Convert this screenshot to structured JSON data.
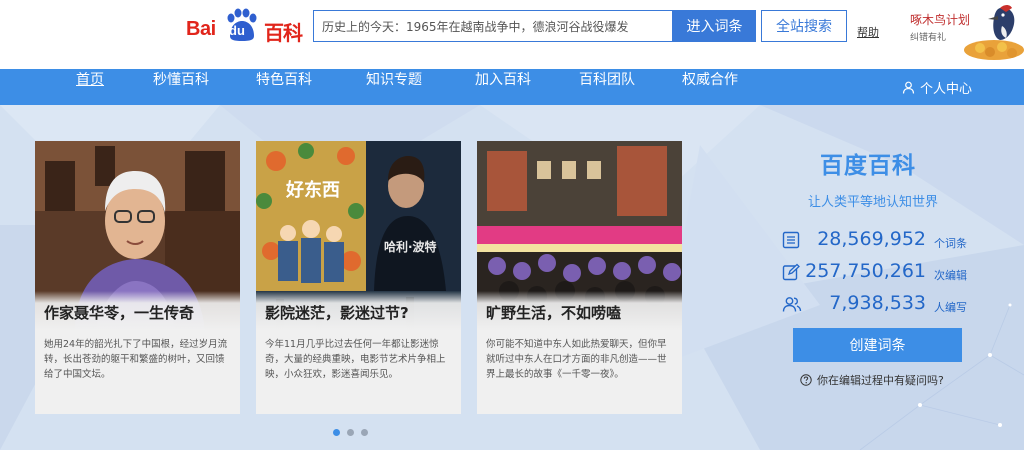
{
  "logo": {
    "part1": "Bai",
    "part2": "du",
    "part3": "百科"
  },
  "search": {
    "value": "历史上的今天：1965年在越南战争中，德浪河谷战役爆发"
  },
  "buttons": {
    "enter": "进入词条",
    "site_search": "全站搜索",
    "help": "帮助"
  },
  "promo": {
    "title": "啄木鸟计划",
    "subtitle": "纠错有礼"
  },
  "nav": {
    "items": [
      "首页",
      "秒懂百科",
      "特色百科",
      "知识专题",
      "加入百科",
      "百科团队",
      "权威合作"
    ],
    "user": "个人中心"
  },
  "cards": [
    {
      "title": "作家聂华苓，一生传奇",
      "desc": "她用24年的韶光扎下了中国根，经过岁月流转，长出苍劲的躯干和繁盛的树叶，又回馈给了中国文坛。"
    },
    {
      "title": "影院迷茫，影迷过节?",
      "desc": "今年11月几乎比过去任何一年都让影迷惊奇，大量的经典重映，电影节艺术片争相上映，小众狂欢，影迷喜闻乐见。",
      "poster_text": "好东西",
      "poster2_text": "哈利·波特"
    },
    {
      "title": "旷野生活，不如唠嗑",
      "desc": "你可能不知道中东人如此热爱聊天，但你早就听过中东人在口才方面的非凡创造——世界上最长的故事《一千零一夜》。"
    }
  ],
  "side": {
    "title": "百度百科",
    "slogan": "让人类平等地认知世界",
    "stats": [
      {
        "icon": "entries-icon",
        "value": "28,569,952",
        "unit": "个词条"
      },
      {
        "icon": "edit-icon",
        "value": "257,750,261",
        "unit": "次编辑"
      },
      {
        "icon": "users-icon",
        "value": "7,938,533",
        "unit": "人编写"
      }
    ],
    "create": "创建词条",
    "faq": "你在编辑过程中有疑问吗?"
  },
  "colors": {
    "brand_red": "#e1251b",
    "brand_blue": "#3d8ee6",
    "nav_bg": "#3d8ee6"
  }
}
